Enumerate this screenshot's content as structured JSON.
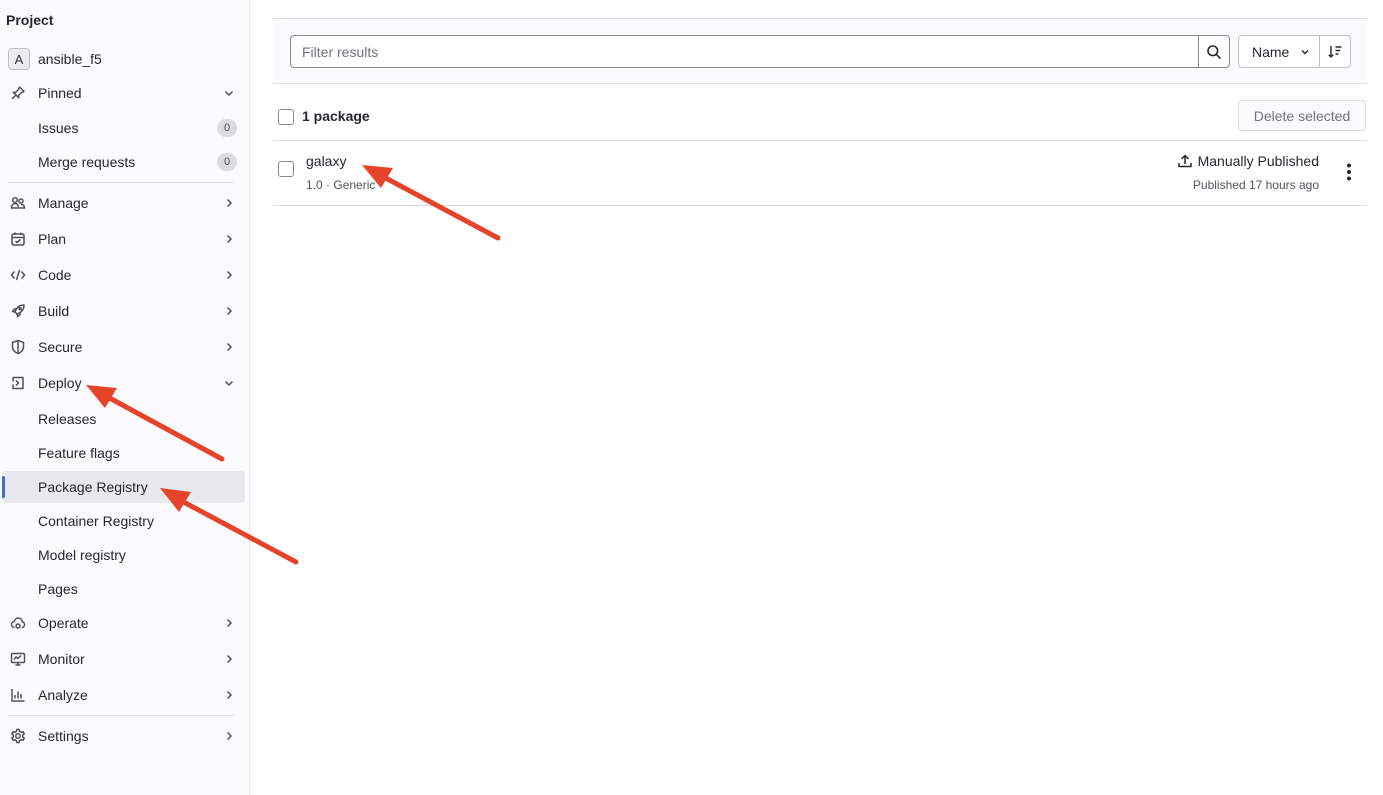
{
  "sidebar": {
    "heading": "Project",
    "project": {
      "avatar_letter": "A",
      "name": "ansible_f5"
    },
    "pinned": {
      "label": "Pinned",
      "items": [
        {
          "label": "Issues",
          "count": "0"
        },
        {
          "label": "Merge requests",
          "count": "0"
        }
      ]
    },
    "sections": {
      "manage": "Manage",
      "plan": "Plan",
      "code": "Code",
      "build": "Build",
      "secure": "Secure",
      "deploy": "Deploy",
      "operate": "Operate",
      "monitor": "Monitor",
      "analyze": "Analyze",
      "settings": "Settings"
    },
    "deploy_items": {
      "releases": "Releases",
      "feature_flags": "Feature flags",
      "package_registry": "Package Registry",
      "container_registry": "Container Registry",
      "model_registry": "Model registry",
      "pages": "Pages"
    },
    "active_item": "Package Registry"
  },
  "filter": {
    "placeholder": "Filter results",
    "sort_label": "Name"
  },
  "list": {
    "count_label": "1 package",
    "delete_label": "Delete selected",
    "packages": [
      {
        "name": "galaxy",
        "version": "1.0",
        "type": "Generic",
        "meta_separator": "·",
        "status": "Manually Published",
        "published": "Published 17 hours ago"
      }
    ]
  },
  "colors": {
    "accent": "#3f6bd6",
    "annotation_arrow": "#e6432b"
  },
  "icons": {
    "pinned": "pin-icon",
    "manage": "users-icon",
    "plan": "calendar-icon",
    "code": "code-icon",
    "build": "rocket-icon",
    "secure": "shield-icon",
    "deploy": "deploy-icon",
    "operate": "cloud-icon",
    "monitor": "monitor-icon",
    "analyze": "chart-icon",
    "settings": "gear-icon"
  }
}
